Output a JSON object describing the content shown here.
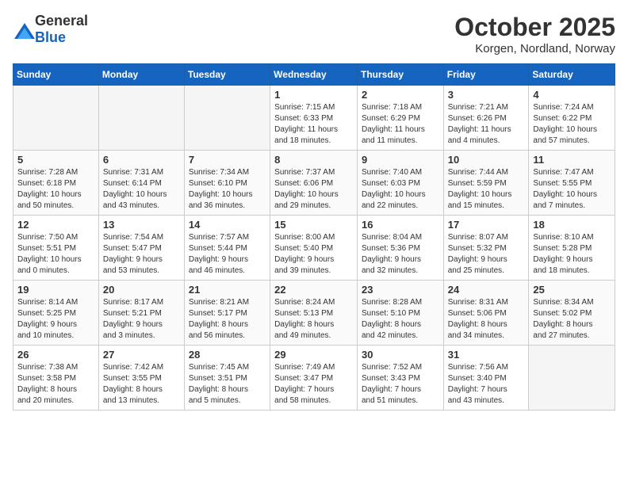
{
  "logo": {
    "general": "General",
    "blue": "Blue"
  },
  "header": {
    "month": "October 2025",
    "location": "Korgen, Nordland, Norway"
  },
  "weekdays": [
    "Sunday",
    "Monday",
    "Tuesday",
    "Wednesday",
    "Thursday",
    "Friday",
    "Saturday"
  ],
  "weeks": [
    [
      {
        "day": "",
        "info": ""
      },
      {
        "day": "",
        "info": ""
      },
      {
        "day": "",
        "info": ""
      },
      {
        "day": "1",
        "info": "Sunrise: 7:15 AM\nSunset: 6:33 PM\nDaylight: 11 hours\nand 18 minutes."
      },
      {
        "day": "2",
        "info": "Sunrise: 7:18 AM\nSunset: 6:29 PM\nDaylight: 11 hours\nand 11 minutes."
      },
      {
        "day": "3",
        "info": "Sunrise: 7:21 AM\nSunset: 6:26 PM\nDaylight: 11 hours\nand 4 minutes."
      },
      {
        "day": "4",
        "info": "Sunrise: 7:24 AM\nSunset: 6:22 PM\nDaylight: 10 hours\nand 57 minutes."
      }
    ],
    [
      {
        "day": "5",
        "info": "Sunrise: 7:28 AM\nSunset: 6:18 PM\nDaylight: 10 hours\nand 50 minutes."
      },
      {
        "day": "6",
        "info": "Sunrise: 7:31 AM\nSunset: 6:14 PM\nDaylight: 10 hours\nand 43 minutes."
      },
      {
        "day": "7",
        "info": "Sunrise: 7:34 AM\nSunset: 6:10 PM\nDaylight: 10 hours\nand 36 minutes."
      },
      {
        "day": "8",
        "info": "Sunrise: 7:37 AM\nSunset: 6:06 PM\nDaylight: 10 hours\nand 29 minutes."
      },
      {
        "day": "9",
        "info": "Sunrise: 7:40 AM\nSunset: 6:03 PM\nDaylight: 10 hours\nand 22 minutes."
      },
      {
        "day": "10",
        "info": "Sunrise: 7:44 AM\nSunset: 5:59 PM\nDaylight: 10 hours\nand 15 minutes."
      },
      {
        "day": "11",
        "info": "Sunrise: 7:47 AM\nSunset: 5:55 PM\nDaylight: 10 hours\nand 7 minutes."
      }
    ],
    [
      {
        "day": "12",
        "info": "Sunrise: 7:50 AM\nSunset: 5:51 PM\nDaylight: 10 hours\nand 0 minutes."
      },
      {
        "day": "13",
        "info": "Sunrise: 7:54 AM\nSunset: 5:47 PM\nDaylight: 9 hours\nand 53 minutes."
      },
      {
        "day": "14",
        "info": "Sunrise: 7:57 AM\nSunset: 5:44 PM\nDaylight: 9 hours\nand 46 minutes."
      },
      {
        "day": "15",
        "info": "Sunrise: 8:00 AM\nSunset: 5:40 PM\nDaylight: 9 hours\nand 39 minutes."
      },
      {
        "day": "16",
        "info": "Sunrise: 8:04 AM\nSunset: 5:36 PM\nDaylight: 9 hours\nand 32 minutes."
      },
      {
        "day": "17",
        "info": "Sunrise: 8:07 AM\nSunset: 5:32 PM\nDaylight: 9 hours\nand 25 minutes."
      },
      {
        "day": "18",
        "info": "Sunrise: 8:10 AM\nSunset: 5:28 PM\nDaylight: 9 hours\nand 18 minutes."
      }
    ],
    [
      {
        "day": "19",
        "info": "Sunrise: 8:14 AM\nSunset: 5:25 PM\nDaylight: 9 hours\nand 10 minutes."
      },
      {
        "day": "20",
        "info": "Sunrise: 8:17 AM\nSunset: 5:21 PM\nDaylight: 9 hours\nand 3 minutes."
      },
      {
        "day": "21",
        "info": "Sunrise: 8:21 AM\nSunset: 5:17 PM\nDaylight: 8 hours\nand 56 minutes."
      },
      {
        "day": "22",
        "info": "Sunrise: 8:24 AM\nSunset: 5:13 PM\nDaylight: 8 hours\nand 49 minutes."
      },
      {
        "day": "23",
        "info": "Sunrise: 8:28 AM\nSunset: 5:10 PM\nDaylight: 8 hours\nand 42 minutes."
      },
      {
        "day": "24",
        "info": "Sunrise: 8:31 AM\nSunset: 5:06 PM\nDaylight: 8 hours\nand 34 minutes."
      },
      {
        "day": "25",
        "info": "Sunrise: 8:34 AM\nSunset: 5:02 PM\nDaylight: 8 hours\nand 27 minutes."
      }
    ],
    [
      {
        "day": "26",
        "info": "Sunrise: 7:38 AM\nSunset: 3:58 PM\nDaylight: 8 hours\nand 20 minutes."
      },
      {
        "day": "27",
        "info": "Sunrise: 7:42 AM\nSunset: 3:55 PM\nDaylight: 8 hours\nand 13 minutes."
      },
      {
        "day": "28",
        "info": "Sunrise: 7:45 AM\nSunset: 3:51 PM\nDaylight: 8 hours\nand 5 minutes."
      },
      {
        "day": "29",
        "info": "Sunrise: 7:49 AM\nSunset: 3:47 PM\nDaylight: 7 hours\nand 58 minutes."
      },
      {
        "day": "30",
        "info": "Sunrise: 7:52 AM\nSunset: 3:43 PM\nDaylight: 7 hours\nand 51 minutes."
      },
      {
        "day": "31",
        "info": "Sunrise: 7:56 AM\nSunset: 3:40 PM\nDaylight: 7 hours\nand 43 minutes."
      },
      {
        "day": "",
        "info": ""
      }
    ]
  ]
}
